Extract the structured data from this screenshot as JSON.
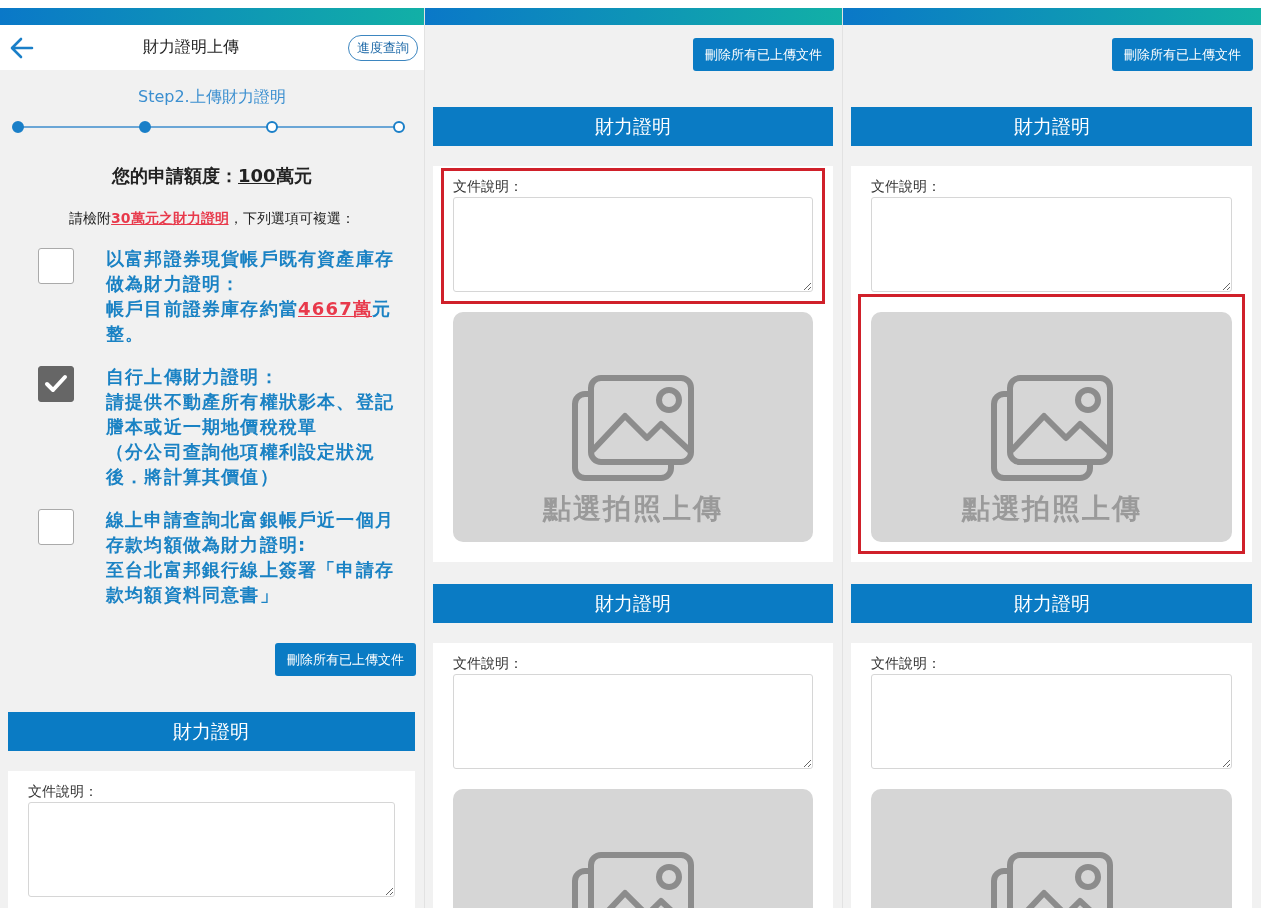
{
  "panels": [
    {
      "kind": "form",
      "header": {
        "title": "財力證明上傳",
        "progress_button": "進度查詢"
      },
      "step_label": "Step2.上傳財力證明",
      "steps": [
        {
          "done": true
        },
        {
          "done": true
        },
        {
          "done": false
        },
        {
          "done": false
        }
      ],
      "amount": {
        "label": "您的申請額度：",
        "value": "100",
        "unit": "萬元"
      },
      "instruction": {
        "before": "請檢附",
        "link": "30萬元之財力證明",
        "after": "，下列選項可複選："
      },
      "options": [
        {
          "checked": false,
          "title": "以富邦證券現貨帳戶既有資產庫存做為財力證明：",
          "details": [
            {
              "before": "帳戶目前證券庫存約當",
              "highlight": "4667萬",
              "after": "元整。"
            }
          ]
        },
        {
          "checked": true,
          "title": "自行上傳財力證明：",
          "details": [
            {
              "before": "請提供不動產所有權狀影本、登記謄本或近一期地價稅稅單"
            },
            {
              "before": "（分公司查詢他項權利設定狀況後．將計算其價值）"
            }
          ]
        },
        {
          "checked": false,
          "title": "線上申請查詢北富銀帳戶近一個月存款均額做為財力證明:",
          "details": [
            {
              "before": "至台北富邦銀行線上簽署「申請存款均額資料同意書」"
            }
          ]
        }
      ],
      "delete_button": "刪除所有已上傳文件",
      "sections": [
        {
          "kind": "field_only",
          "title": "財力證明",
          "field_label": "文件說明："
        }
      ]
    },
    {
      "kind": "uploads",
      "delete_button": "刪除所有已上傳文件",
      "sections": [
        {
          "kind": "upload",
          "title": "財力證明",
          "field_label": "文件說明：",
          "field_highlighted": true,
          "photo_highlighted": false,
          "photo_caption": "點選拍照上傳"
        },
        {
          "kind": "upload",
          "title": "財力證明",
          "field_label": "文件說明：",
          "field_highlighted": false,
          "photo_highlighted": false
        }
      ]
    },
    {
      "kind": "uploads",
      "delete_button": "刪除所有已上傳文件",
      "sections": [
        {
          "kind": "upload",
          "title": "財力證明",
          "field_label": "文件說明：",
          "field_highlighted": false,
          "photo_highlighted": true,
          "photo_caption": "點選拍照上傳"
        },
        {
          "kind": "upload",
          "title": "財力證明",
          "field_label": "文件說明：",
          "field_highlighted": false,
          "photo_highlighted": false
        }
      ]
    }
  ]
}
